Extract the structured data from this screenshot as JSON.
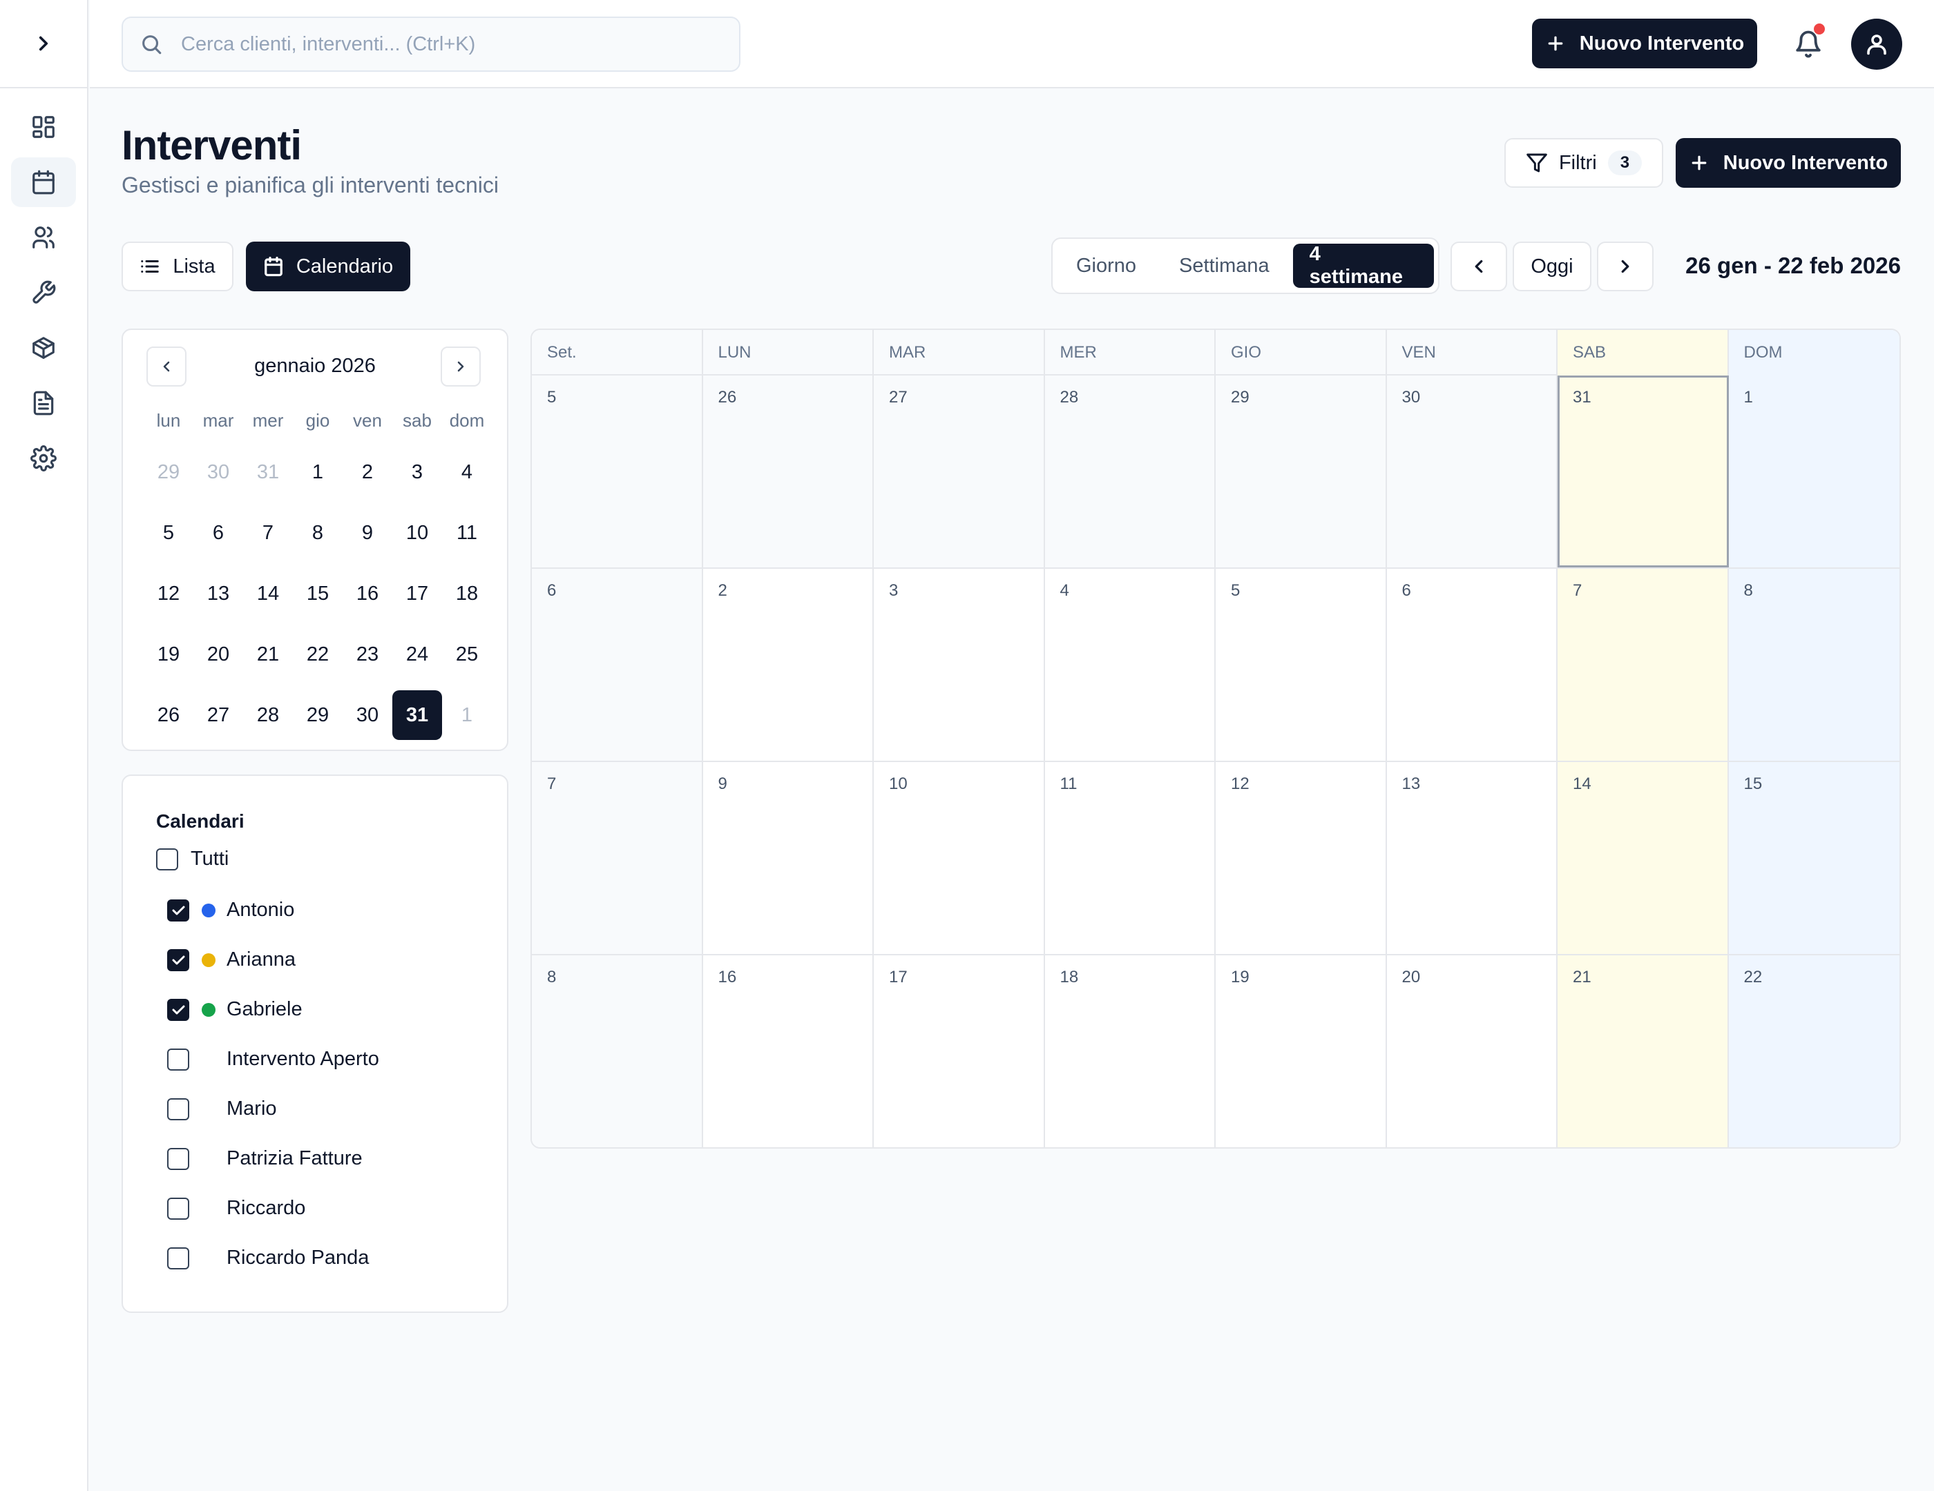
{
  "search": {
    "placeholder": "Cerca clienti, interventi... (Ctrl+K)"
  },
  "topbar": {
    "new_button": "Nuovo Intervento"
  },
  "sidebar": {
    "items": [
      {
        "name": "dashboard",
        "icon": "layout-grid-icon"
      },
      {
        "name": "calendar",
        "icon": "calendar-icon",
        "active": true
      },
      {
        "name": "clients",
        "icon": "users-icon"
      },
      {
        "name": "tools",
        "icon": "wrench-icon"
      },
      {
        "name": "products",
        "icon": "package-icon"
      },
      {
        "name": "documents",
        "icon": "file-text-icon"
      },
      {
        "name": "settings",
        "icon": "gear-icon"
      }
    ]
  },
  "page": {
    "title": "Interventi",
    "subtitle": "Gestisci e pianifica gli interventi tecnici",
    "filters_label": "Filtri",
    "filters_count": "3",
    "new_button": "Nuovo Intervento"
  },
  "views": {
    "list": "Lista",
    "calendar": "Calendario"
  },
  "range_modes": [
    "Giorno",
    "Settimana",
    "4 settimane"
  ],
  "range_active": "4 settimane",
  "nav": {
    "today": "Oggi",
    "range_label": "26 gen - 22 feb 2026"
  },
  "mini_calendar": {
    "title": "gennaio 2026",
    "weekdays": [
      "lun",
      "mar",
      "mer",
      "gio",
      "ven",
      "sab",
      "dom"
    ],
    "days": [
      {
        "d": "29",
        "out": true
      },
      {
        "d": "30",
        "out": true
      },
      {
        "d": "31",
        "out": true
      },
      {
        "d": "1"
      },
      {
        "d": "2"
      },
      {
        "d": "3"
      },
      {
        "d": "4"
      },
      {
        "d": "5"
      },
      {
        "d": "6"
      },
      {
        "d": "7"
      },
      {
        "d": "8"
      },
      {
        "d": "9"
      },
      {
        "d": "10"
      },
      {
        "d": "11"
      },
      {
        "d": "12"
      },
      {
        "d": "13"
      },
      {
        "d": "14"
      },
      {
        "d": "15"
      },
      {
        "d": "16"
      },
      {
        "d": "17"
      },
      {
        "d": "18"
      },
      {
        "d": "19"
      },
      {
        "d": "20"
      },
      {
        "d": "21"
      },
      {
        "d": "22"
      },
      {
        "d": "23"
      },
      {
        "d": "24"
      },
      {
        "d": "25"
      },
      {
        "d": "26"
      },
      {
        "d": "27"
      },
      {
        "d": "28"
      },
      {
        "d": "29"
      },
      {
        "d": "30"
      },
      {
        "d": "31",
        "selected": true
      },
      {
        "d": "1",
        "out": true
      }
    ]
  },
  "calendars": {
    "title": "Calendari",
    "all_label": "Tutti",
    "all_checked": false,
    "items": [
      {
        "name": "Antonio",
        "checked": true,
        "color": "#2563eb"
      },
      {
        "name": "Arianna",
        "checked": true,
        "color": "#eab308"
      },
      {
        "name": "Gabriele",
        "checked": true,
        "color": "#16a34a"
      },
      {
        "name": "Intervento Aperto",
        "checked": false,
        "color": ""
      },
      {
        "name": "Mario",
        "checked": false,
        "color": ""
      },
      {
        "name": "Patrizia Fatture",
        "checked": false,
        "color": ""
      },
      {
        "name": "Riccardo",
        "checked": false,
        "color": ""
      },
      {
        "name": "Riccardo Panda",
        "checked": false,
        "color": ""
      }
    ]
  },
  "grid": {
    "headers": [
      "Set.",
      "LUN",
      "MAR",
      "MER",
      "GIO",
      "VEN",
      "SAB",
      "DOM"
    ],
    "rows": [
      {
        "week": "5",
        "days": [
          "26",
          "27",
          "28",
          "29",
          "30",
          "31",
          "1"
        ],
        "past": true,
        "today_index": 5
      },
      {
        "week": "6",
        "days": [
          "2",
          "3",
          "4",
          "5",
          "6",
          "7",
          "8"
        ]
      },
      {
        "week": "7",
        "days": [
          "9",
          "10",
          "11",
          "12",
          "13",
          "14",
          "15"
        ]
      },
      {
        "week": "8",
        "days": [
          "16",
          "17",
          "18",
          "19",
          "20",
          "21",
          "22"
        ]
      }
    ]
  }
}
